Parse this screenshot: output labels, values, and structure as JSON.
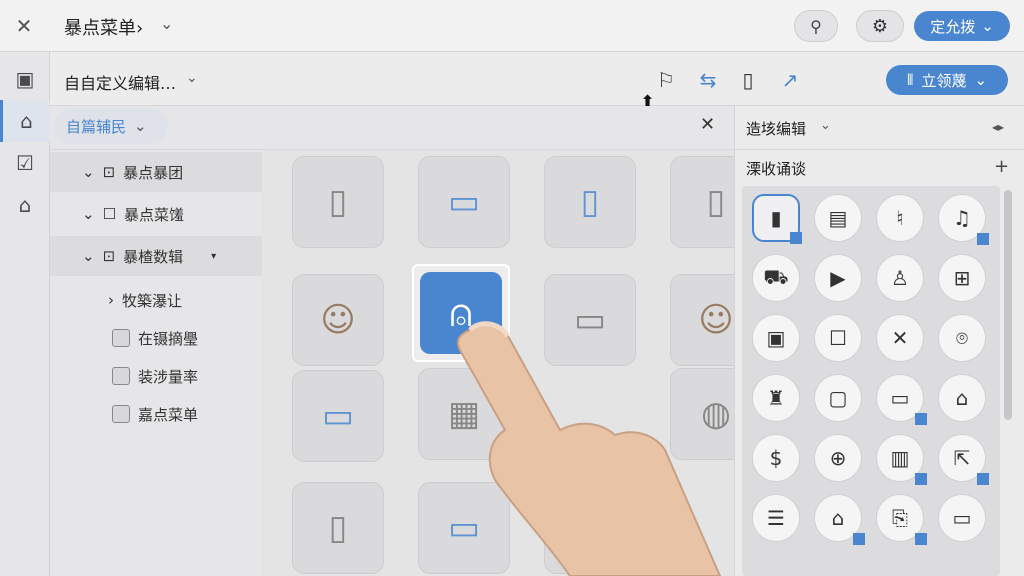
{
  "header": {
    "app_title": "暴点菜单›",
    "preview_icon": "preview-icon",
    "settings_icon": "gear-icon",
    "confirm_label": "定允拨"
  },
  "rail": [
    {
      "icon": "page-icon",
      "glyph": "▣"
    },
    {
      "icon": "home-outline-icon",
      "glyph": "⌂"
    },
    {
      "icon": "calendar-icon",
      "glyph": "☑"
    },
    {
      "icon": "house-icon",
      "glyph": "⌂"
    }
  ],
  "editor": {
    "title": "自自定义编辑…",
    "publish_label": "立领蔑",
    "tools": [
      "alert-user-icon",
      "swap-icon",
      "device-icon",
      "share-icon"
    ]
  },
  "panel": {
    "tab_label": "自篇辅民",
    "tree": [
      {
        "label": "暴点暴团",
        "kind": "group"
      },
      {
        "label": "暴点菜馐",
        "kind": "group"
      },
      {
        "label": "暴楂数辑",
        "kind": "group"
      },
      {
        "label": "牧築瀑让",
        "kind": "item"
      },
      {
        "label": "在镊摘璺",
        "kind": "check"
      },
      {
        "label": "装涉量率",
        "kind": "check"
      },
      {
        "label": "嘉点菜单",
        "kind": "check"
      }
    ]
  },
  "right_panel": {
    "title": "造垓编辑",
    "section_title": "溧收诵谈",
    "icons": [
      "phone-icon",
      "document-icon",
      "bell-icon",
      "music-note-icon",
      "truck-icon",
      "play-icon",
      "user-icon",
      "grid-icon",
      "image-icon",
      "box-icon",
      "shuffle-icon",
      "location-pin-icon",
      "lamp-icon",
      "tablet-icon",
      "landscape-icon",
      "home-outline-icon",
      "shield-dollar-icon",
      "game-controller-icon",
      "frame-icon",
      "export-icon",
      "barcode-icon",
      "house-icon",
      "clipboard-icon",
      "monitor-icon"
    ]
  }
}
